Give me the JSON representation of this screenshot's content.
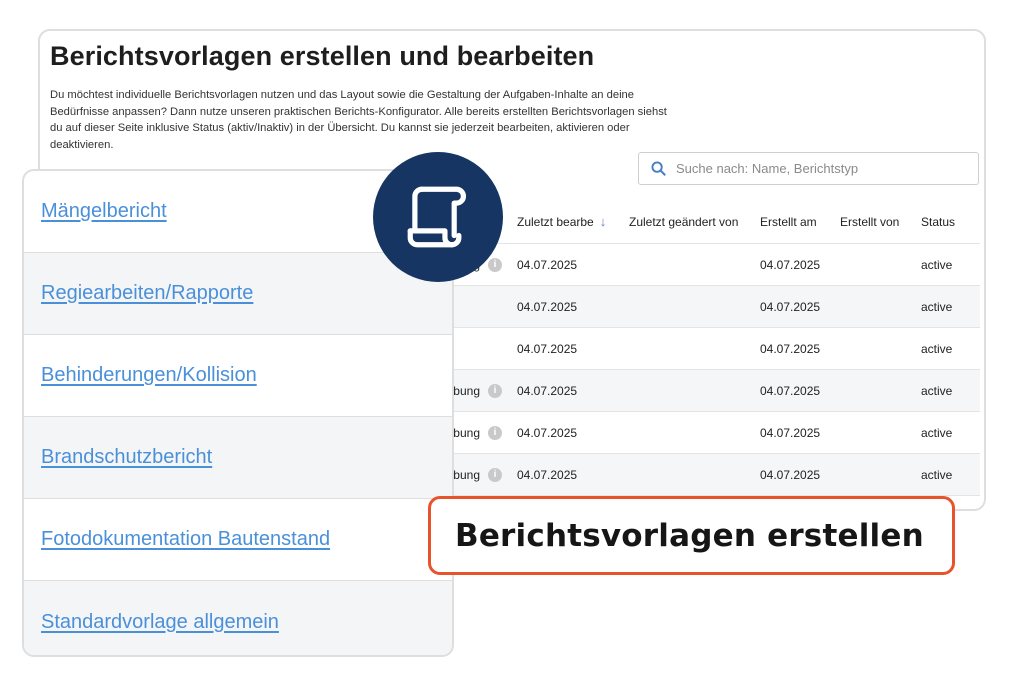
{
  "page": {
    "title": "Berichtsvorlagen erstellen und bearbeiten",
    "description": "Du möchtest individuelle Berichtsvorlagen nutzen und das Layout sowie die Gestaltung der Aufgaben-Inhalte an deine Bedürfnisse anpassen? Dann nutze unseren praktischen Berichts-Konfigurator. Alle bereits erstellten Berichtsvorlagen siehst du auf dieser Seite inklusive Status (aktiv/Inaktiv) in der Übersicht. Du kannst sie jederzeit bearbeiten, aktivieren oder deaktivieren."
  },
  "search": {
    "placeholder": "Suche nach: Name, Berichtstyp",
    "icon": "search-icon"
  },
  "table": {
    "headers": {
      "updated": "Zuletzt bearbe",
      "updated_by": "Zuletzt geändert von",
      "created": "Erstellt am",
      "created_by": "Erstellt von",
      "status": "Status"
    },
    "rows": [
      {
        "name": "ng",
        "info": "i",
        "updated": "04.07.2025",
        "created": "04.07.2025",
        "status": "active"
      },
      {
        "name": "",
        "info": "",
        "updated": "04.07.2025",
        "created": "04.07.2025",
        "status": "active"
      },
      {
        "name": "",
        "info": "",
        "updated": "04.07.2025",
        "created": "04.07.2025",
        "status": "active"
      },
      {
        "name": "bung",
        "info": "i",
        "updated": "04.07.2025",
        "created": "04.07.2025",
        "status": "active"
      },
      {
        "name": "bung",
        "info": "i",
        "updated": "04.07.2025",
        "created": "04.07.2025",
        "status": "active"
      },
      {
        "name": "bung",
        "info": "i",
        "updated": "04.07.2025",
        "created": "04.07.2025",
        "status": "active"
      }
    ]
  },
  "templates": [
    {
      "label": "Mängelbericht"
    },
    {
      "label": "Regiearbeiten/Rapporte"
    },
    {
      "label": "Behinderungen/Kollision"
    },
    {
      "label": "Brandschutzbericht"
    },
    {
      "label": "Fotodokumentation Bautenstand"
    },
    {
      "label": "Standardvorlage allgemein"
    }
  ],
  "badge": {
    "icon": "scroll-document-icon",
    "color": "#163563"
  },
  "callout": {
    "text": "Berichtsvorlagen erstellen",
    "border_color": "#e9532b"
  },
  "colors": {
    "link": "#4a90d9",
    "row_alt": "#f5f6f8"
  }
}
